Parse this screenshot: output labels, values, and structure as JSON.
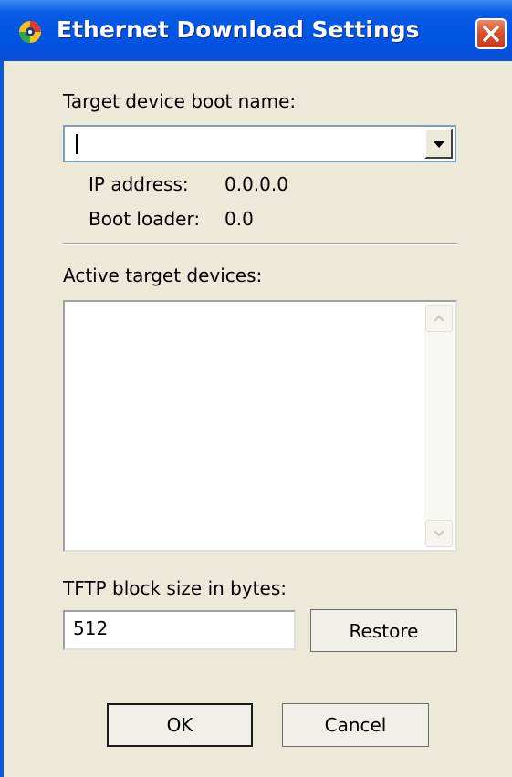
{
  "window": {
    "title": "Ethernet Download Settings",
    "close_label": "×"
  },
  "boot_name": {
    "label": "Target device boot name:",
    "value": ""
  },
  "info": {
    "ip_label": "IP address:",
    "ip_value": "0.0.0.0",
    "bootloader_label": "Boot loader:",
    "bootloader_value": "0.0"
  },
  "active_devices": {
    "label": "Active target devices:",
    "items": []
  },
  "tftp": {
    "label": "TFTP block size in bytes:",
    "value": "512",
    "restore_label": "Restore"
  },
  "buttons": {
    "ok_label": "OK",
    "cancel_label": "Cancel"
  },
  "colors": {
    "titlebar": "#0054e3",
    "dialog_bg": "#ece9d8",
    "close_button": "#d9532f"
  }
}
